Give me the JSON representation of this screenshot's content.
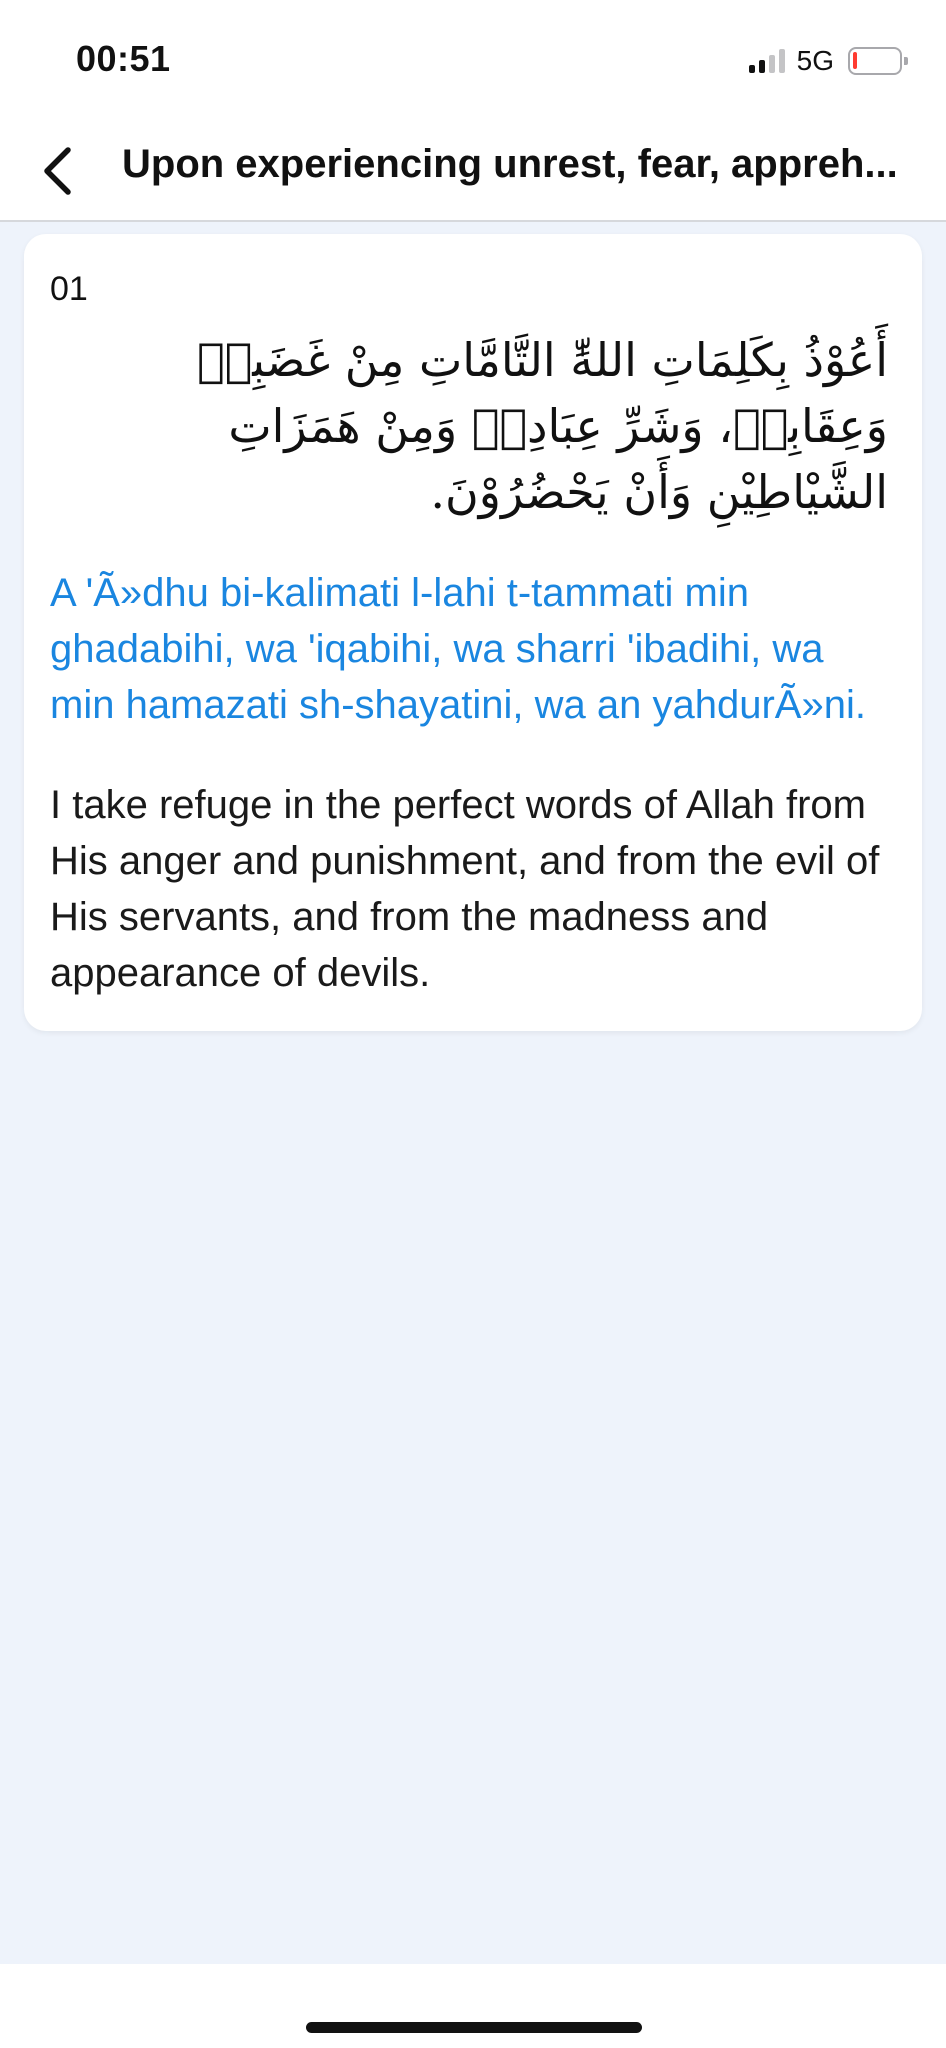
{
  "status_bar": {
    "time": "00:51",
    "network": "5G",
    "icons": [
      "cellular-signal-icon",
      "battery-low-icon"
    ],
    "battery_color": "#ff3b30"
  },
  "nav": {
    "back_icon": "chevron-left-icon",
    "title": "Upon experiencing unrest, fear, appreh..."
  },
  "dua": {
    "number": "01",
    "arabic": "أَعُوْذُ بِكَلِمَاتِ اللهِّٰ التَّامَّاتِ مِنْ غَضَبِهٖ وَعِقَابِهٖ، وَشَرِّ عِبَادِهٖ وَمِنْ هَمَزَاتِ الشَّيْاطِيْنِ وَأَنْ يَحْضُرُوْنَ.",
    "transliteration": "A 'Ã»dhu bi-kalimati l-lahi t-tammati min ghadabihi, wa 'iqabihi, wa sharri 'ibadihi, wa min hamazati sh-shayatini, wa an yahdurÃ»ni.",
    "translation": "I take refuge in the perfect words of Allah from His anger and punishment, and from the evil of His servants, and from the madness and appearance of devils."
  },
  "colors": {
    "accent": "#1a86e0",
    "background": "#eef3fb",
    "card": "#ffffff"
  }
}
